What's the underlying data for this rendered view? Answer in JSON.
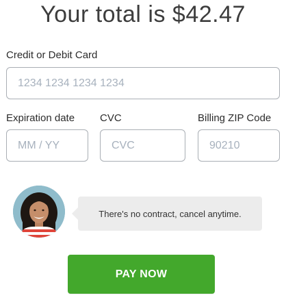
{
  "title": "Your total is $42.47",
  "card": {
    "label": "Credit or Debit Card",
    "placeholder": "1234 1234 1234 1234"
  },
  "expiration": {
    "label": "Expiration date",
    "placeholder": "MM / YY"
  },
  "cvc": {
    "label": "CVC",
    "placeholder": "CVC"
  },
  "zip": {
    "label": "Billing ZIP Code",
    "placeholder": "90210"
  },
  "message": {
    "text": "There's no contract, cancel anytime.",
    "avatar_icon": "person-photo-icon"
  },
  "pay_button": {
    "label": "PAY NOW"
  },
  "colors": {
    "accent_green": "#43a82c",
    "input_border": "#a9aeb4",
    "placeholder": "#a7b1bd",
    "bubble_bg": "#ececec"
  }
}
